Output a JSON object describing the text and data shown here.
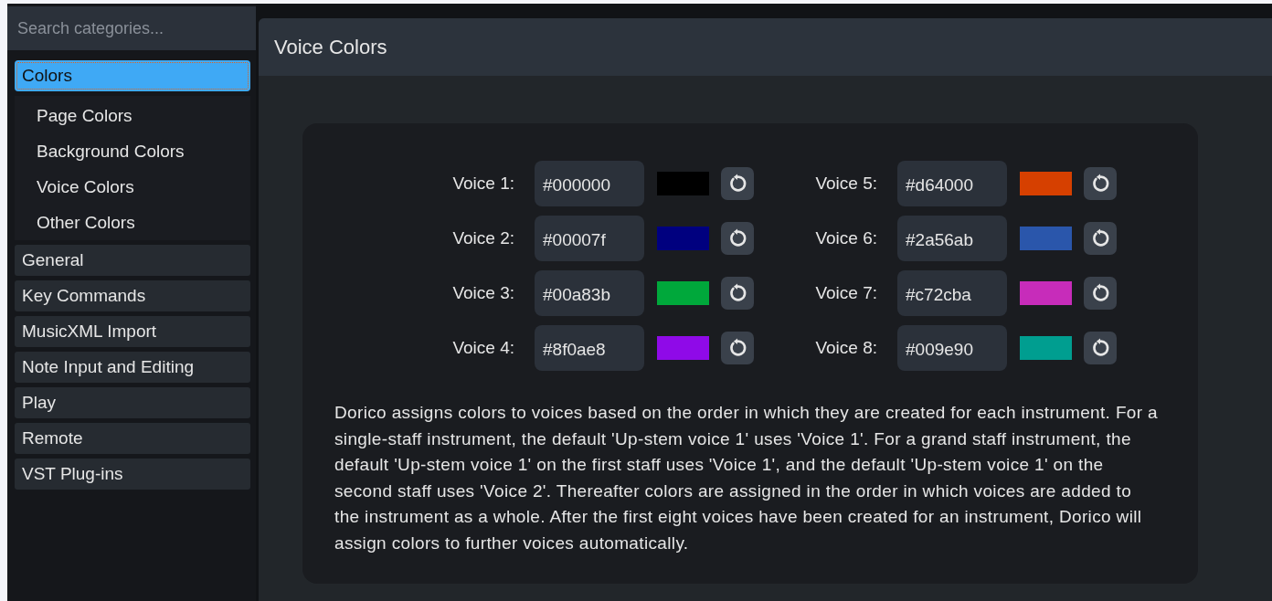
{
  "sidebar": {
    "search": {
      "placeholder": "Search categories..."
    },
    "items": [
      {
        "label": "Colors",
        "selected": true,
        "children": [
          {
            "label": "Page Colors",
            "selected": false
          },
          {
            "label": "Background Colors",
            "selected": false
          },
          {
            "label": "Voice Colors",
            "selected": false
          },
          {
            "label": "Other Colors",
            "selected": false
          }
        ]
      },
      {
        "label": "General",
        "selected": false
      },
      {
        "label": "Key Commands",
        "selected": false
      },
      {
        "label": "MusicXML Import",
        "selected": false
      },
      {
        "label": "Note Input and Editing",
        "selected": false
      },
      {
        "label": "Play",
        "selected": false
      },
      {
        "label": "Remote",
        "selected": false
      },
      {
        "label": "VST Plug-ins",
        "selected": false
      }
    ]
  },
  "panel": {
    "title": "Voice Colors",
    "voices": [
      {
        "label": "Voice 1:",
        "value": "#000000",
        "color": "#000000"
      },
      {
        "label": "Voice 2:",
        "value": "#00007f",
        "color": "#00007f"
      },
      {
        "label": "Voice 3:",
        "value": "#00a83b",
        "color": "#00a83b"
      },
      {
        "label": "Voice 4:",
        "value": "#8f0ae8",
        "color": "#8f0ae8"
      },
      {
        "label": "Voice 5:",
        "value": "#d64000",
        "color": "#d64000"
      },
      {
        "label": "Voice 6:",
        "value": "#2a56ab",
        "color": "#2a56ab"
      },
      {
        "label": "Voice 7:",
        "value": "#c72cba",
        "color": "#c72cba"
      },
      {
        "label": "Voice 8:",
        "value": "#009e90",
        "color": "#009e90"
      }
    ],
    "description": "Dorico assigns colors to voices based on the order in which they are created for each instrument. For a single-staff instrument, the default 'Up-stem voice 1' uses 'Voice 1'. For a grand staff instrument, the default 'Up-stem voice 1' on the first staff uses 'Voice 1', and the default 'Up-stem voice 1' on the second staff uses 'Voice 2'. Thereafter colors are assigned in the order in which voices are added to the instrument as a whole. After the first eight voices have been created for an instrument, Dorico will assign colors to further voices automatically."
  }
}
